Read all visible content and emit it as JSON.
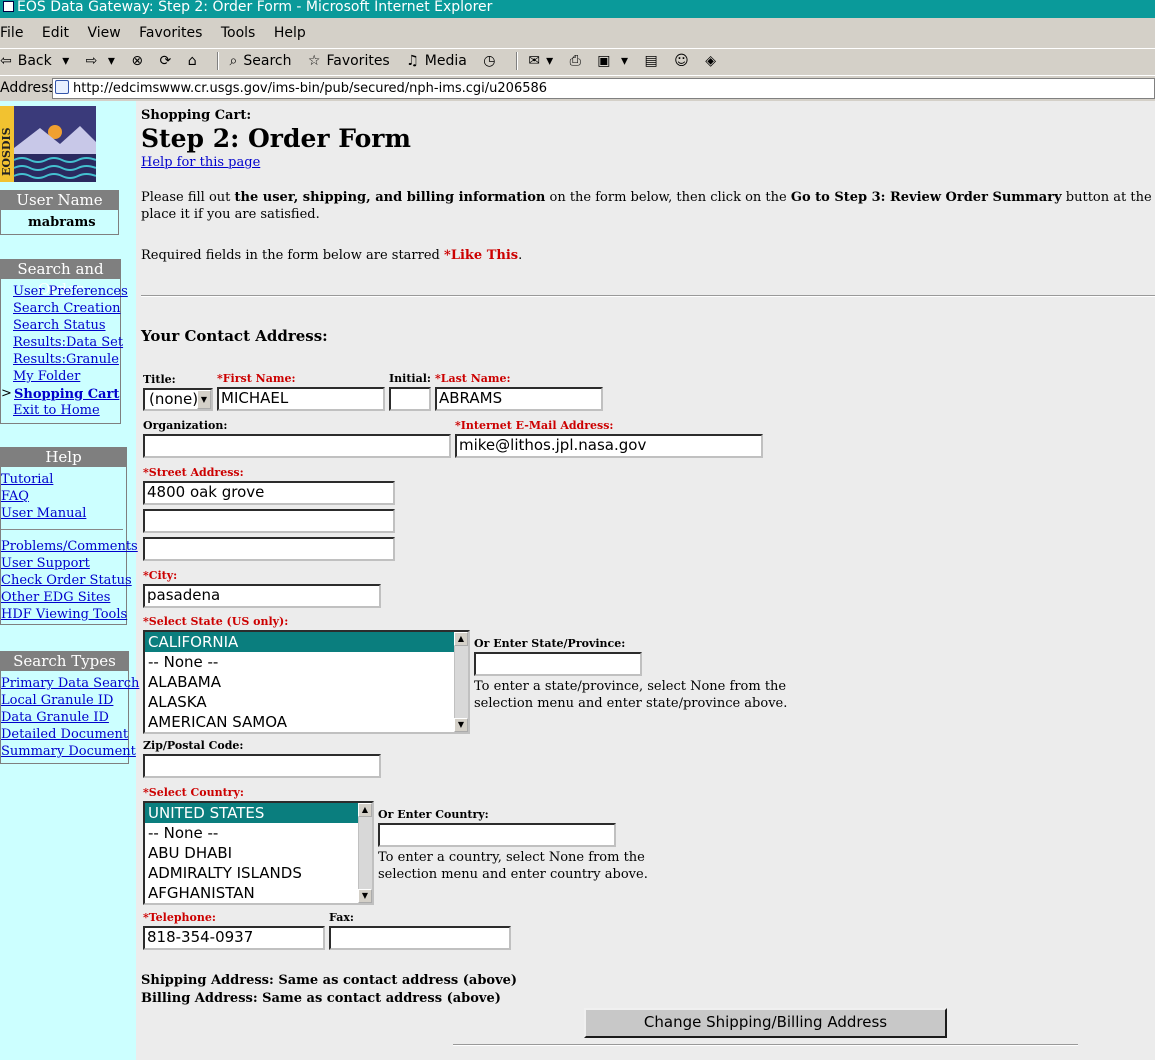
{
  "window": {
    "title": "EOS Data Gateway: Step 2: Order Form - Microsoft Internet Explorer"
  },
  "menu": [
    "File",
    "Edit",
    "View",
    "Favorites",
    "Tools",
    "Help"
  ],
  "toolbar": {
    "back": "Back",
    "search": "Search",
    "favorites": "Favorites",
    "media": "Media"
  },
  "address": {
    "label": "Address",
    "url": "http://edcimswww.cr.usgs.gov/ims-bin/pub/secured/nph-ims.cgi/u206586"
  },
  "sidebar": {
    "logo_text": "EOSDIS",
    "user_name_head": "User Name",
    "user_name": "mabrams",
    "search_order_head": "Search and Order",
    "search_order_items": [
      "User Preferences",
      "Search Creation",
      "Search Status",
      "Results:Data Set",
      "Results:Granule",
      "My Folder",
      "Shopping Cart",
      "Exit to Home"
    ],
    "current_marker": ">",
    "help_head": "Help",
    "help_items": [
      "Tutorial",
      "FAQ",
      "User Manual"
    ],
    "support_items": [
      "Problems/Comments",
      "User Support",
      "Check Order Status",
      "Other EDG Sites",
      "HDF Viewing Tools"
    ],
    "search_types_head": "Search Types",
    "search_types_items": [
      "Primary Data Search",
      "Local Granule ID",
      "Data Granule ID",
      "Detailed Document",
      "Summary Document"
    ]
  },
  "page": {
    "cart_label": "Shopping Cart:",
    "heading": "Step 2: Order Form",
    "help_link": "Help for this page",
    "intro_1": "Please fill out ",
    "intro_bold_1": "the user, shipping, and billing information",
    "intro_2": " on the form below, then click on the ",
    "intro_bold_2": "Go to Step 3: Review Order Summary",
    "intro_3": " button at the bottom of the page.",
    "intro_line2": "place it if you are satisfied.",
    "required_text": "Required fields in the form below are starred ",
    "required_example": "*Like This",
    "required_period": ".",
    "contact_heading": "Your Contact Address:"
  },
  "form": {
    "title_label": "Title:",
    "title_value": "(none)",
    "first_name_label": "*First Name:",
    "first_name_value": "MICHAEL",
    "initial_label": "Initial:",
    "initial_value": "",
    "last_name_label": "*Last Name:",
    "last_name_value": "ABRAMS",
    "org_label": "Organization:",
    "org_value": "",
    "email_label": "*Internet E-Mail Address:",
    "email_value": "mike@lithos.jpl.nasa.gov",
    "street_label": "*Street Address:",
    "street_1": "4800 oak grove",
    "street_2": "",
    "street_3": "",
    "city_label": "*City:",
    "city_value": "pasadena",
    "state_label": "*Select State (US only):",
    "state_options": [
      "CALIFORNIA",
      "-- None --",
      "ALABAMA",
      "ALASKA",
      "AMERICAN SAMOA"
    ],
    "state_other_label": "Or Enter State/Province:",
    "state_other_value": "",
    "state_hint_1": "To enter a state/province, select None from the",
    "state_hint_2": "selection menu and enter state/province above.",
    "zip_label": "Zip/Postal Code:",
    "zip_value": "",
    "country_label": "*Select Country:",
    "country_options": [
      "UNITED STATES",
      "-- None --",
      "ABU DHABI",
      "ADMIRALTY ISLANDS",
      "AFGHANISTAN"
    ],
    "country_other_label": "Or Enter Country:",
    "country_other_value": "",
    "country_hint_1": "To enter a country, select None from the",
    "country_hint_2": "selection menu and enter country above.",
    "phone_label": "*Telephone:",
    "phone_value": "818-354-0937",
    "fax_label": "Fax:",
    "fax_value": "",
    "shipping_text": "Shipping Address: Same as contact address (above)",
    "billing_text": "Billing Address: Same as contact address (above)",
    "change_button": "Change Shipping/Billing Address"
  }
}
